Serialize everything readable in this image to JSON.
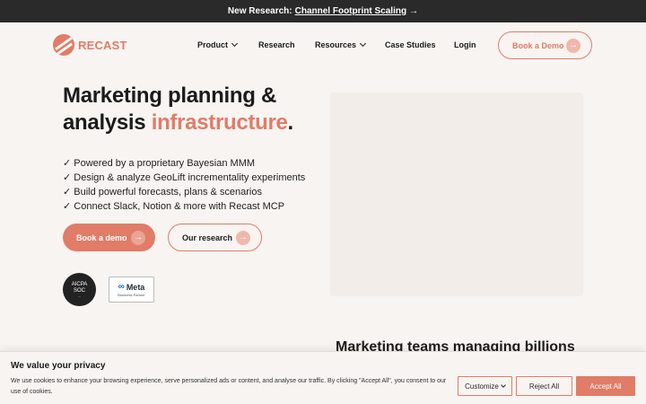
{
  "announcement": {
    "prefix": "New Research:",
    "link": "Channel Footprint Scaling",
    "arrow": "→"
  },
  "brand": {
    "name": "RECAST",
    "color": "#e07c68"
  },
  "nav": {
    "product": "Product",
    "research": "Research",
    "resources": "Resources",
    "case_studies": "Case Studies",
    "login": "Login",
    "cta": "Book a Demo"
  },
  "hero": {
    "title_line1": "Marketing planning &",
    "title_line2_plain": "analysis ",
    "title_accent": "infrastructure",
    "title_end": ".",
    "features": [
      "✓ Powered by a proprietary Bayesian MMM",
      "✓ Design & analyze GeoLift incrementality experiments",
      "✓ Build powerful forecasts, plans & scenarios",
      "✓ Connect Slack, Notion & more with Recast MCP"
    ],
    "primary_button": "Book a demo",
    "secondary_button": "Our research",
    "button_arrow": "→"
  },
  "badges": {
    "soc_line1": "AICPA",
    "soc_line2": "SOC",
    "meta_name": "Meta",
    "meta_sub": "Business Partner"
  },
  "section": {
    "title": "Marketing teams managing billions"
  },
  "cookie": {
    "title": "We value your privacy",
    "text": "We use cookies to enhance your browsing experience, serve personalized ads or content, and analyse our traffic. By clicking \"Accept All\", you consent to our use of cookies.",
    "customize": "Customize",
    "reject": "Reject All",
    "accept": "Accept All"
  },
  "icons": [
    "logo-icon",
    "arrow-right-icon",
    "chevron-down-icon",
    "meta-infinity-icon"
  ]
}
